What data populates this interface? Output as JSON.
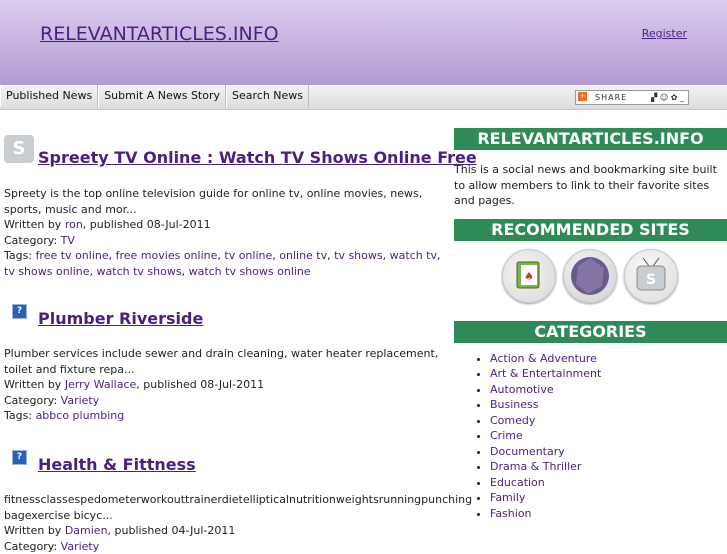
{
  "header": {
    "site_title": "RELEVANTARTICLES.INFO",
    "register": "Register"
  },
  "nav": {
    "items": [
      "Published News",
      "Submit A News Story",
      "Search News"
    ],
    "share_label": "SHARE"
  },
  "articles": [
    {
      "title": "Spreety TV Online : Watch TV Shows Online Free",
      "summary": "Spreety is the top online television guide for online tv, online movies, news, sports, music and mor...",
      "written_prefix": "Written by ",
      "author": "ron",
      "published": ", published 08-Jul-2011",
      "category_prefix": "Category: ",
      "category": "TV",
      "tags_prefix": "Tags: ",
      "tags": [
        "free tv online",
        "free movies online",
        "tv online",
        "online tv",
        "tv shows",
        "watch tv",
        "tv shows online",
        "watch tv shows",
        "watch tv shows online"
      ]
    },
    {
      "title": "Plumber Riverside",
      "summary": "Plumber services include sewer and drain cleaning, water heater replacement, toilet and fixture repa...",
      "written_prefix": "Written by ",
      "author": "Jerry Wallace",
      "published": ", published 08-Jul-2011",
      "category_prefix": "Category: ",
      "category": "Variety",
      "tags_prefix": "Tags: ",
      "tags": [
        "abbco plumbing"
      ]
    },
    {
      "title": "Health & Fittness",
      "summary": "fitnessclassespedometerworkouttrainerdietellipticalnutritionweightsrunningpunching bagexercise bicyc...",
      "written_prefix": "Written by ",
      "author": "Damien",
      "published": ", published 04-Jul-2011",
      "category_prefix": "Category: ",
      "category": "Variety"
    }
  ],
  "sidebar": {
    "site_heading": "RELEVANTARTICLES.INFO",
    "description": "This is a social news and bookmarking site built to allow members to link to their favorite sites and pages.",
    "recommended_heading": "RECOMMENDED SITES",
    "categories_heading": "CATEGORIES",
    "categories": [
      "Action & Adventure",
      "Art & Entertainment",
      "Automotive",
      "Business",
      "Comedy",
      "Crime",
      "Documentary",
      "Drama & Thriller",
      "Education",
      "Family",
      "Fashion"
    ]
  },
  "colors": {
    "accent": "#4b1f82",
    "sidebar_header": "#2e8b57"
  }
}
